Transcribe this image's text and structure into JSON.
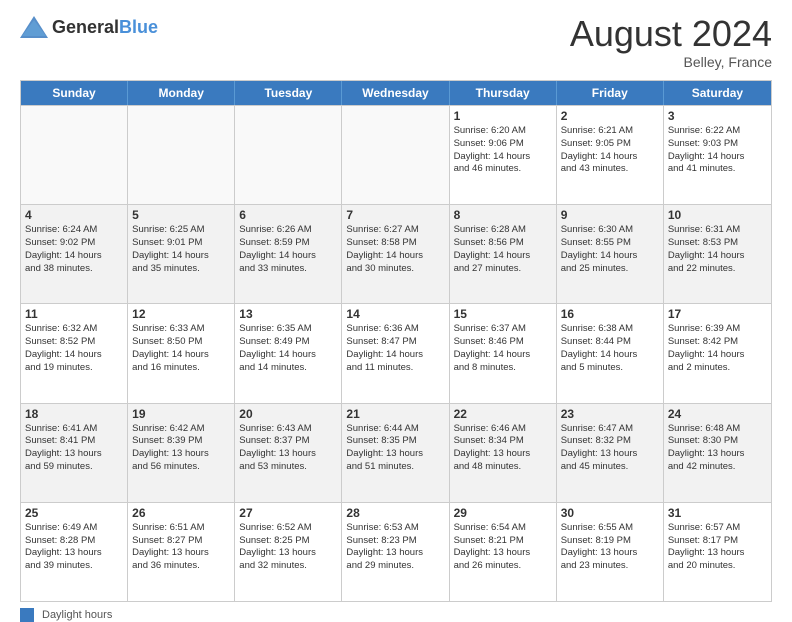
{
  "header": {
    "logo_general": "General",
    "logo_blue": "Blue",
    "month_year": "August 2024",
    "location": "Belley, France"
  },
  "calendar": {
    "days_of_week": [
      "Sunday",
      "Monday",
      "Tuesday",
      "Wednesday",
      "Thursday",
      "Friday",
      "Saturday"
    ],
    "weeks": [
      [
        {
          "day": "",
          "info": [],
          "empty": true
        },
        {
          "day": "",
          "info": [],
          "empty": true
        },
        {
          "day": "",
          "info": [],
          "empty": true
        },
        {
          "day": "",
          "info": [],
          "empty": true
        },
        {
          "day": "1",
          "info": [
            "Sunrise: 6:20 AM",
            "Sunset: 9:06 PM",
            "Daylight: 14 hours",
            "and 46 minutes."
          ],
          "empty": false
        },
        {
          "day": "2",
          "info": [
            "Sunrise: 6:21 AM",
            "Sunset: 9:05 PM",
            "Daylight: 14 hours",
            "and 43 minutes."
          ],
          "empty": false
        },
        {
          "day": "3",
          "info": [
            "Sunrise: 6:22 AM",
            "Sunset: 9:03 PM",
            "Daylight: 14 hours",
            "and 41 minutes."
          ],
          "empty": false
        }
      ],
      [
        {
          "day": "4",
          "info": [
            "Sunrise: 6:24 AM",
            "Sunset: 9:02 PM",
            "Daylight: 14 hours",
            "and 38 minutes."
          ],
          "empty": false
        },
        {
          "day": "5",
          "info": [
            "Sunrise: 6:25 AM",
            "Sunset: 9:01 PM",
            "Daylight: 14 hours",
            "and 35 minutes."
          ],
          "empty": false
        },
        {
          "day": "6",
          "info": [
            "Sunrise: 6:26 AM",
            "Sunset: 8:59 PM",
            "Daylight: 14 hours",
            "and 33 minutes."
          ],
          "empty": false
        },
        {
          "day": "7",
          "info": [
            "Sunrise: 6:27 AM",
            "Sunset: 8:58 PM",
            "Daylight: 14 hours",
            "and 30 minutes."
          ],
          "empty": false
        },
        {
          "day": "8",
          "info": [
            "Sunrise: 6:28 AM",
            "Sunset: 8:56 PM",
            "Daylight: 14 hours",
            "and 27 minutes."
          ],
          "empty": false
        },
        {
          "day": "9",
          "info": [
            "Sunrise: 6:30 AM",
            "Sunset: 8:55 PM",
            "Daylight: 14 hours",
            "and 25 minutes."
          ],
          "empty": false
        },
        {
          "day": "10",
          "info": [
            "Sunrise: 6:31 AM",
            "Sunset: 8:53 PM",
            "Daylight: 14 hours",
            "and 22 minutes."
          ],
          "empty": false
        }
      ],
      [
        {
          "day": "11",
          "info": [
            "Sunrise: 6:32 AM",
            "Sunset: 8:52 PM",
            "Daylight: 14 hours",
            "and 19 minutes."
          ],
          "empty": false
        },
        {
          "day": "12",
          "info": [
            "Sunrise: 6:33 AM",
            "Sunset: 8:50 PM",
            "Daylight: 14 hours",
            "and 16 minutes."
          ],
          "empty": false
        },
        {
          "day": "13",
          "info": [
            "Sunrise: 6:35 AM",
            "Sunset: 8:49 PM",
            "Daylight: 14 hours",
            "and 14 minutes."
          ],
          "empty": false
        },
        {
          "day": "14",
          "info": [
            "Sunrise: 6:36 AM",
            "Sunset: 8:47 PM",
            "Daylight: 14 hours",
            "and 11 minutes."
          ],
          "empty": false
        },
        {
          "day": "15",
          "info": [
            "Sunrise: 6:37 AM",
            "Sunset: 8:46 PM",
            "Daylight: 14 hours",
            "and 8 minutes."
          ],
          "empty": false
        },
        {
          "day": "16",
          "info": [
            "Sunrise: 6:38 AM",
            "Sunset: 8:44 PM",
            "Daylight: 14 hours",
            "and 5 minutes."
          ],
          "empty": false
        },
        {
          "day": "17",
          "info": [
            "Sunrise: 6:39 AM",
            "Sunset: 8:42 PM",
            "Daylight: 14 hours",
            "and 2 minutes."
          ],
          "empty": false
        }
      ],
      [
        {
          "day": "18",
          "info": [
            "Sunrise: 6:41 AM",
            "Sunset: 8:41 PM",
            "Daylight: 13 hours",
            "and 59 minutes."
          ],
          "empty": false
        },
        {
          "day": "19",
          "info": [
            "Sunrise: 6:42 AM",
            "Sunset: 8:39 PM",
            "Daylight: 13 hours",
            "and 56 minutes."
          ],
          "empty": false
        },
        {
          "day": "20",
          "info": [
            "Sunrise: 6:43 AM",
            "Sunset: 8:37 PM",
            "Daylight: 13 hours",
            "and 53 minutes."
          ],
          "empty": false
        },
        {
          "day": "21",
          "info": [
            "Sunrise: 6:44 AM",
            "Sunset: 8:35 PM",
            "Daylight: 13 hours",
            "and 51 minutes."
          ],
          "empty": false
        },
        {
          "day": "22",
          "info": [
            "Sunrise: 6:46 AM",
            "Sunset: 8:34 PM",
            "Daylight: 13 hours",
            "and 48 minutes."
          ],
          "empty": false
        },
        {
          "day": "23",
          "info": [
            "Sunrise: 6:47 AM",
            "Sunset: 8:32 PM",
            "Daylight: 13 hours",
            "and 45 minutes."
          ],
          "empty": false
        },
        {
          "day": "24",
          "info": [
            "Sunrise: 6:48 AM",
            "Sunset: 8:30 PM",
            "Daylight: 13 hours",
            "and 42 minutes."
          ],
          "empty": false
        }
      ],
      [
        {
          "day": "25",
          "info": [
            "Sunrise: 6:49 AM",
            "Sunset: 8:28 PM",
            "Daylight: 13 hours",
            "and 39 minutes."
          ],
          "empty": false
        },
        {
          "day": "26",
          "info": [
            "Sunrise: 6:51 AM",
            "Sunset: 8:27 PM",
            "Daylight: 13 hours",
            "and 36 minutes."
          ],
          "empty": false
        },
        {
          "day": "27",
          "info": [
            "Sunrise: 6:52 AM",
            "Sunset: 8:25 PM",
            "Daylight: 13 hours",
            "and 32 minutes."
          ],
          "empty": false
        },
        {
          "day": "28",
          "info": [
            "Sunrise: 6:53 AM",
            "Sunset: 8:23 PM",
            "Daylight: 13 hours",
            "and 29 minutes."
          ],
          "empty": false
        },
        {
          "day": "29",
          "info": [
            "Sunrise: 6:54 AM",
            "Sunset: 8:21 PM",
            "Daylight: 13 hours",
            "and 26 minutes."
          ],
          "empty": false
        },
        {
          "day": "30",
          "info": [
            "Sunrise: 6:55 AM",
            "Sunset: 8:19 PM",
            "Daylight: 13 hours",
            "and 23 minutes."
          ],
          "empty": false
        },
        {
          "day": "31",
          "info": [
            "Sunrise: 6:57 AM",
            "Sunset: 8:17 PM",
            "Daylight: 13 hours",
            "and 20 minutes."
          ],
          "empty": false
        }
      ]
    ]
  },
  "legend": {
    "label": "Daylight hours"
  }
}
